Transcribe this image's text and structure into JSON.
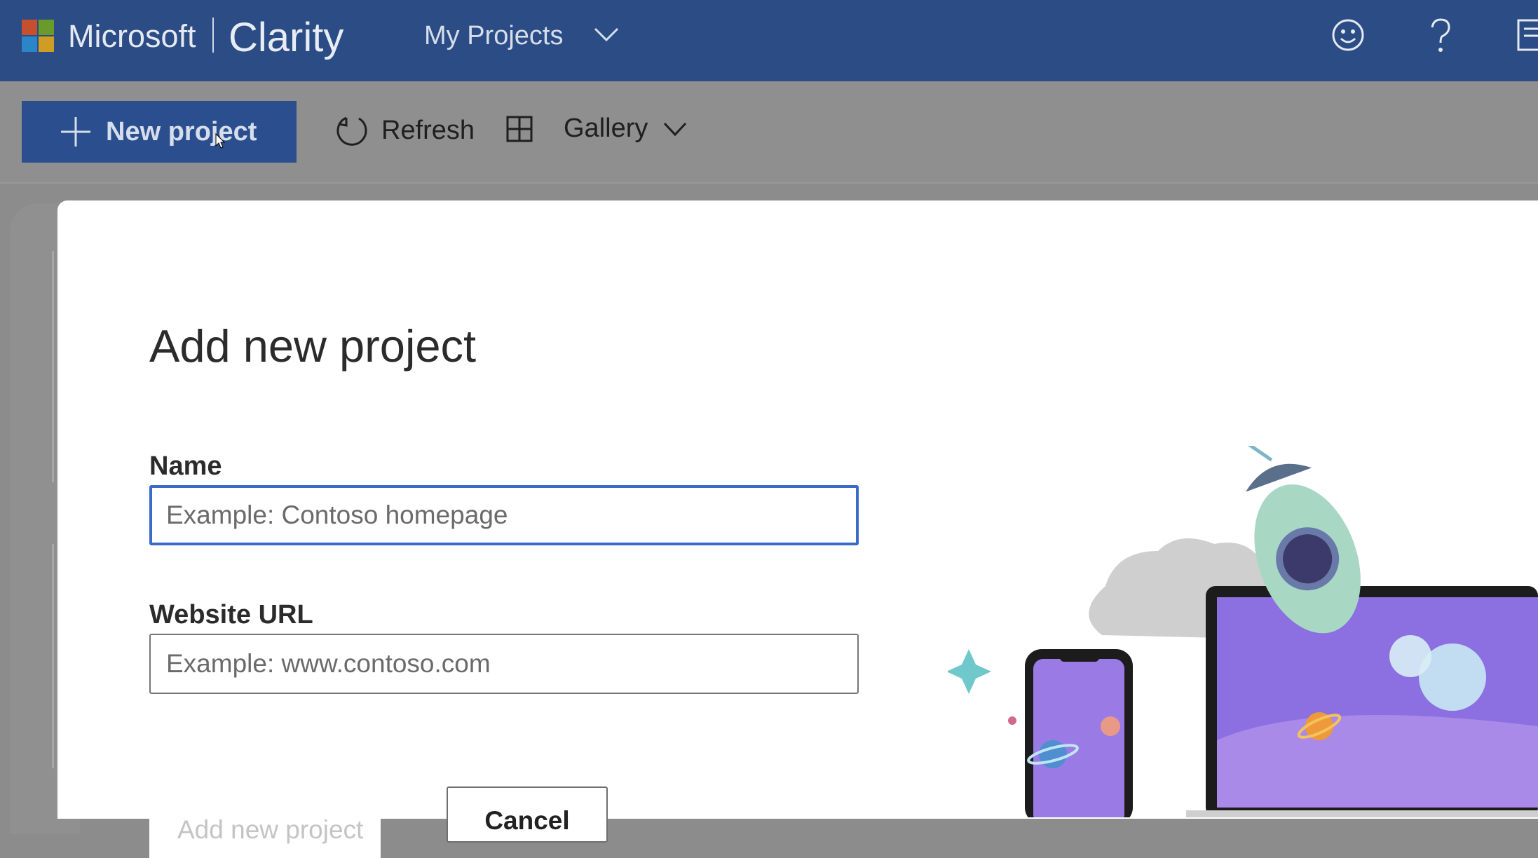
{
  "header": {
    "brand_company": "Microsoft",
    "brand_product": "Clarity",
    "project_switcher": "My Projects",
    "icons": [
      "feedback-smiley-icon",
      "help-icon",
      "notes-icon"
    ]
  },
  "commandbar": {
    "new_project": "New project",
    "refresh": "Refresh",
    "gallery": "Gallery"
  },
  "modal": {
    "title": "Add new project",
    "name_label": "Name",
    "name_placeholder": "Example: Contoso homepage",
    "name_value": "",
    "url_label": "Website URL",
    "url_placeholder": "Example: www.contoso.com",
    "url_value": "",
    "add_button": "Add new project",
    "cancel_button": "Cancel"
  },
  "colors": {
    "header_bg": "#2b4c84",
    "primary_button": "#2b4f8e",
    "focus_border": "#3a6bc8",
    "overlay": "#8f8f8f",
    "ms_red": "#f25022",
    "ms_green": "#7fba00",
    "ms_blue": "#00a4ef",
    "ms_yellow": "#ffb900"
  }
}
